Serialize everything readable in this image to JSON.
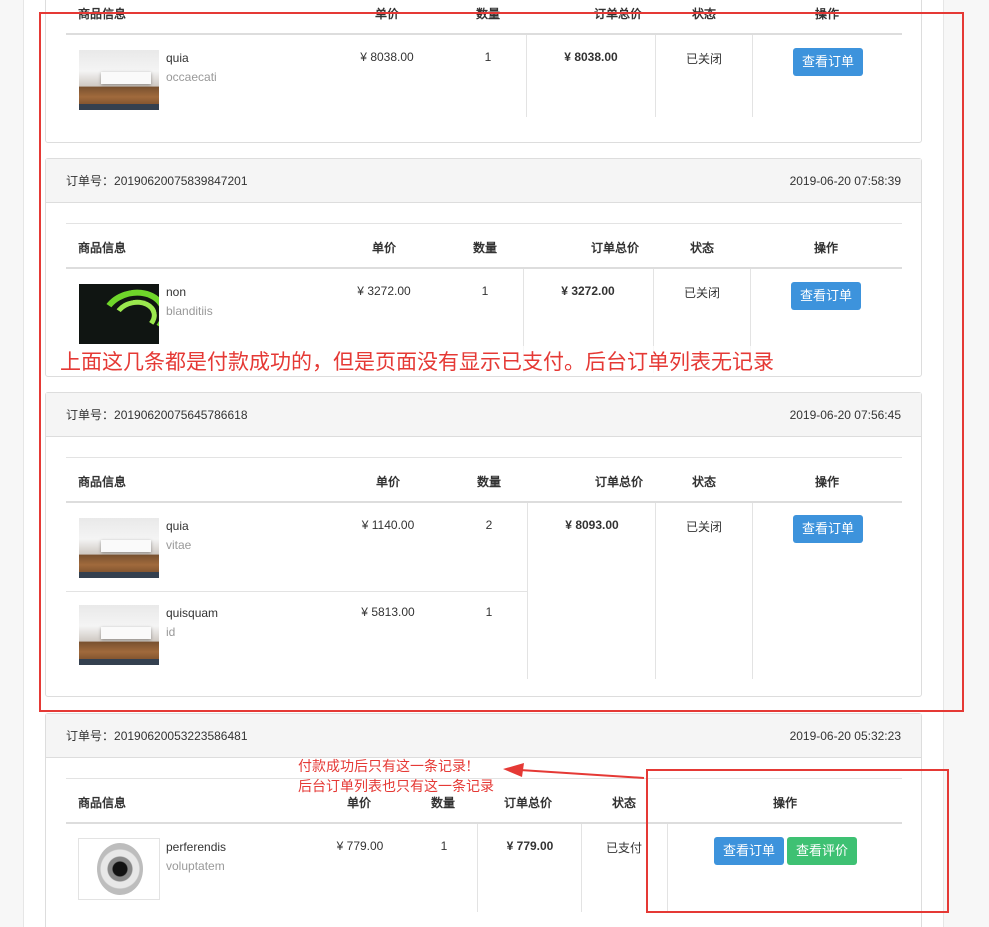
{
  "headers": {
    "product_info": "商品信息",
    "unit_price": "单价",
    "quantity": "数量",
    "order_total": "订单总价",
    "status": "状态",
    "action": "操作"
  },
  "order_no_label": "订单号：",
  "orders": [
    {
      "order_no": "",
      "time": "",
      "items": [
        {
          "name": "quia",
          "desc": "occaecati",
          "price": "¥ 8038.00",
          "qty": "1",
          "image": "projector-image"
        }
      ],
      "total": "¥ 8038.00",
      "status": "已关闭",
      "buttons": [
        "查看订单"
      ]
    },
    {
      "order_no": "20190620075839847201",
      "time": "2019-06-20 07:58:39",
      "items": [
        {
          "name": "non",
          "desc": "blanditiis",
          "price": "¥ 3272.00",
          "qty": "1",
          "image": "neon-image"
        }
      ],
      "total": "¥ 3272.00",
      "status": "已关闭",
      "buttons": [
        "查看订单"
      ]
    },
    {
      "order_no": "20190620075645786618",
      "time": "2019-06-20 07:56:45",
      "items": [
        {
          "name": "quia",
          "desc": "vitae",
          "price": "¥ 1140.00",
          "qty": "2",
          "image": "projector-image"
        },
        {
          "name": "quisquam",
          "desc": "id",
          "price": "¥ 5813.00",
          "qty": "1",
          "image": "projector-image"
        }
      ],
      "total": "¥ 8093.00",
      "status": "已关闭",
      "buttons": [
        "查看订单"
      ]
    },
    {
      "order_no": "20190620053223586481",
      "time": "2019-06-20 05:32:23",
      "items": [
        {
          "name": "perferendis",
          "desc": "voluptatem",
          "price": "¥ 779.00",
          "qty": "1",
          "image": "camera-image"
        }
      ],
      "total": "¥ 779.00",
      "status": "已支付",
      "buttons": [
        "查看订单",
        "查看评价"
      ]
    }
  ],
  "annotations": {
    "main_note": "上面这几条都是付款成功的，但是页面没有显示已支付。后台订单列表无记录",
    "side_note_line1": "付款成功后只有这一条记录!",
    "side_note_line2": "后台订单列表也只有这一条记录",
    "color": "#e53935"
  },
  "colors": {
    "button_blue": "#3d93dc",
    "button_green": "#3ec173"
  }
}
